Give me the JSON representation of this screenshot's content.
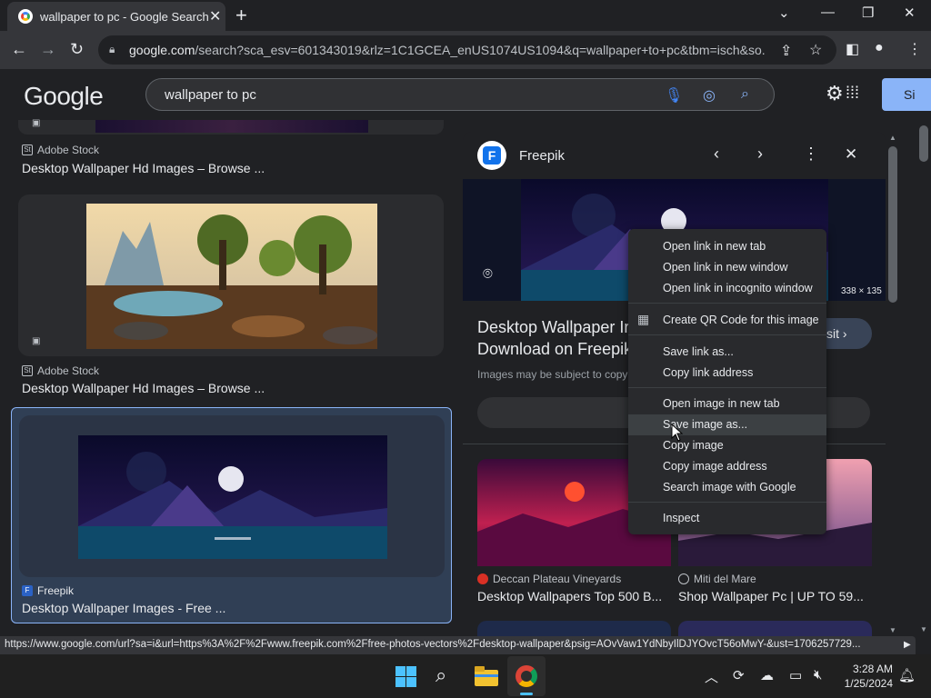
{
  "browser": {
    "tab_title": "wallpaper to pc - Google Search",
    "url_host": "google.com",
    "url_rest": "/search?sca_esv=601343019&rlz=1C1GCEA_enUS1074US1094&q=wallpaper+to+pc&tbm=isch&so...",
    "status_url": "https://www.google.com/url?sa=i&url=https%3A%2F%2Fwww.freepik.com%2Ffree-photos-vectors%2Fdesktop-wallpaper&psig=AOvVaw1YdNbyIlDJYOvcT56oMwY-&ust=1706257729..."
  },
  "google": {
    "logo": "Google",
    "query": "wallpaper to pc",
    "signin": "Si"
  },
  "results_left": [
    {
      "source": "Adobe Stock",
      "title": "Desktop Wallpaper Hd Images – Browse ..."
    },
    {
      "source": "Adobe Stock",
      "title": "Desktop Wallpaper Hd Images – Browse ..."
    },
    {
      "source": "Freepik",
      "title": "Desktop Wallpaper Images - Free ..."
    }
  ],
  "panel": {
    "site": "Freepik",
    "dims": "338 × 135",
    "title_line1": "Desktop Wallpaper Ir",
    "title_line2": "Download on Freepik",
    "notice": "Images may be subject to copy",
    "visit": "sit",
    "related": [
      {
        "source": "Deccan Plateau Vineyards",
        "title": "Desktop Wallpapers Top 500 B..."
      },
      {
        "source": "Miti del Mare",
        "title": "Shop Wallpaper Pc | UP TO 59..."
      }
    ]
  },
  "context_menu": {
    "items": [
      "Open link in new tab",
      "Open link in new window",
      "Open link in incognito window",
      "Create QR Code for this image",
      "Save link as...",
      "Copy link address",
      "Open image in new tab",
      "Save image as...",
      "Copy image",
      "Copy image address",
      "Search image with Google",
      "Inspect"
    ]
  },
  "taskbar": {
    "time": "3:28 AM",
    "date": "1/25/2024"
  }
}
